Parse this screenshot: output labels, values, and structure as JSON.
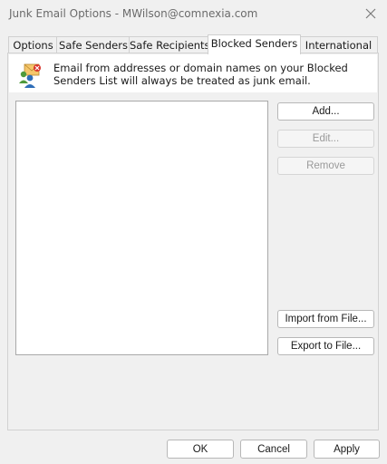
{
  "window": {
    "title": "Junk Email Options - MWilson@comnexia.com"
  },
  "tabs": [
    {
      "label": "Options"
    },
    {
      "label": "Safe Senders"
    },
    {
      "label": "Safe Recipients"
    },
    {
      "label": "Blocked Senders",
      "active": true
    },
    {
      "label": "International"
    }
  ],
  "panel": {
    "description": "Email from addresses or domain names on your Blocked Senders List will always be treated as junk email.",
    "blocked_senders_list": []
  },
  "buttons": {
    "add": "Add...",
    "edit": "Edit...",
    "remove": "Remove",
    "import": "Import from File...",
    "export": "Export to File..."
  },
  "footer": {
    "ok": "OK",
    "cancel": "Cancel",
    "apply": "Apply"
  },
  "colors": {
    "background": "#f0f0f0",
    "panel_header": "#ffffff",
    "disabled_text": "#9a9a9a"
  }
}
